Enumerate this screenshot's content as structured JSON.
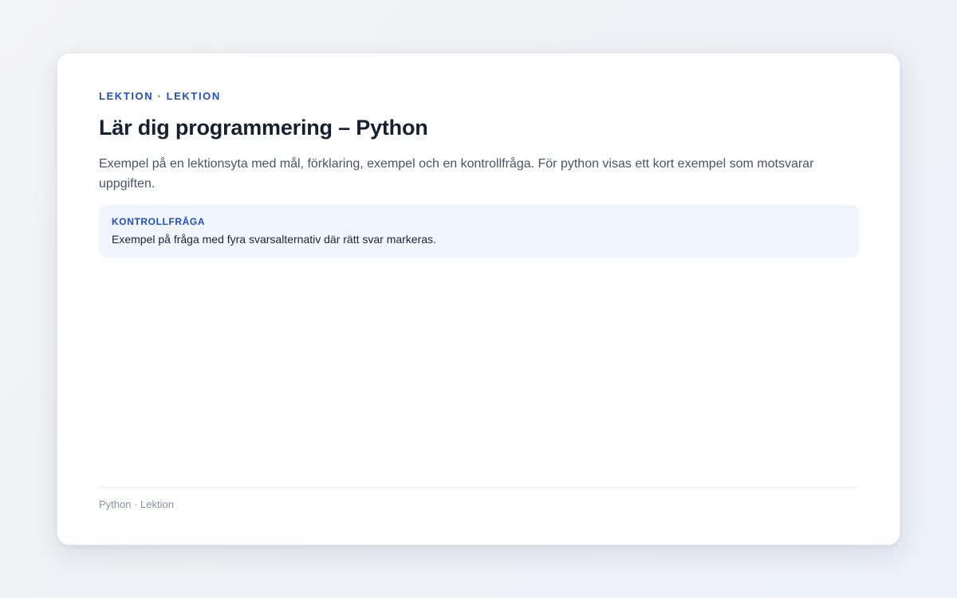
{
  "lesson": {
    "eyebrow": "LEKTION · LEKTION",
    "title": "Lär dig programmering – Python",
    "description": "Exempel på en lektionsyta med mål, förklaring, exempel och en kontrollfråga. För python visas ett kort exempel som motsvarar uppgiften."
  },
  "quiz": {
    "heading": "KONTROLLFRÅGA",
    "text": "Exempel på fråga med fyra svarsalternativ där rätt svar markeras."
  },
  "footer": {
    "text": "Python · Lektion"
  },
  "colors": {
    "accent": "#1f4fc2",
    "title": "#162033",
    "body_text": "#4a5266",
    "quiz_background": "#f1f5fe",
    "footer_text": "#8a90a0"
  }
}
